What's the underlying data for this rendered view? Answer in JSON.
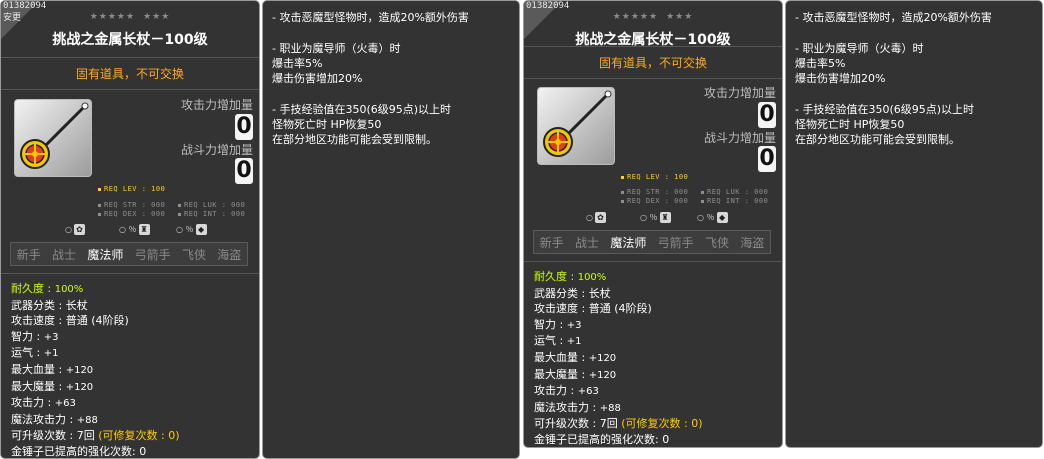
{
  "item_id": "01382094",
  "item_id_sub": "安更",
  "stars": [
    "★★★★★",
    "★★★"
  ],
  "item_name": "挑战之金属长杖－100级",
  "untradeable": "固有道具，不可交换",
  "stat_labels": {
    "attack_increase": "攻击力增加量",
    "combat_increase": "战斗力增加量"
  },
  "stat_values": {
    "attack_increase": "0",
    "combat_increase": "0"
  },
  "requirements": {
    "lev": "REQ LEV : 100",
    "str": "REQ STR : 000",
    "luk": "REQ LUK : 000",
    "dex": "REQ DEX : 000",
    "int": "REQ INT : 000"
  },
  "badges": [
    {
      "prefix": "○",
      "icon": "pet-icon"
    },
    {
      "prefix": "○ ％",
      "icon": "armor-icon"
    },
    {
      "prefix": "○ ％",
      "icon": "shield-icon"
    }
  ],
  "jobs": [
    "新手",
    "战士",
    "魔法师",
    "弓箭手",
    "飞侠",
    "海盗"
  ],
  "active_job": "魔法师",
  "stats": {
    "durability_label": "耐久度",
    "durability_value": "100%",
    "weapon_type_label": "武器分类",
    "weapon_type_value": "长杖",
    "attack_speed_label": "攻击速度",
    "attack_speed_value": "普通 (4阶段)",
    "int_label": "智力",
    "int_value": "+3",
    "luk_label": "运气",
    "luk_value": "+1",
    "max_hp_label": "最大血量",
    "max_hp_value": "+120",
    "max_mp_label": "最大魔量",
    "max_mp_value": "+120",
    "attack_label": "攻击力",
    "attack_value": "+63",
    "magic_attack_label": "魔法攻击力",
    "magic_attack_value": "+88",
    "upgrades_label": "可升级次数",
    "upgrades_value": "7回",
    "repairs_text": "(可修复次数 : 0)",
    "hammer_label": "金锤子已提高的强化次数",
    "hammer_value": "0"
  },
  "description": [
    "- 攻击恶魔型怪物时，造成20%额外伤害",
    "",
    "- 职业为魔导师（火毒）时",
    "爆击率5%",
    "爆击伤害增加20%",
    "",
    "- 手技经验值在350(6级95点)以上时",
    "怪物死亡时 HP恢复50",
    "在部分地区功能可能会受到限制。"
  ],
  "colors": {
    "panel_bg": "#333333",
    "gold": "#ffcc00",
    "lime": "#ccff00",
    "orange": "#ffaa22"
  }
}
